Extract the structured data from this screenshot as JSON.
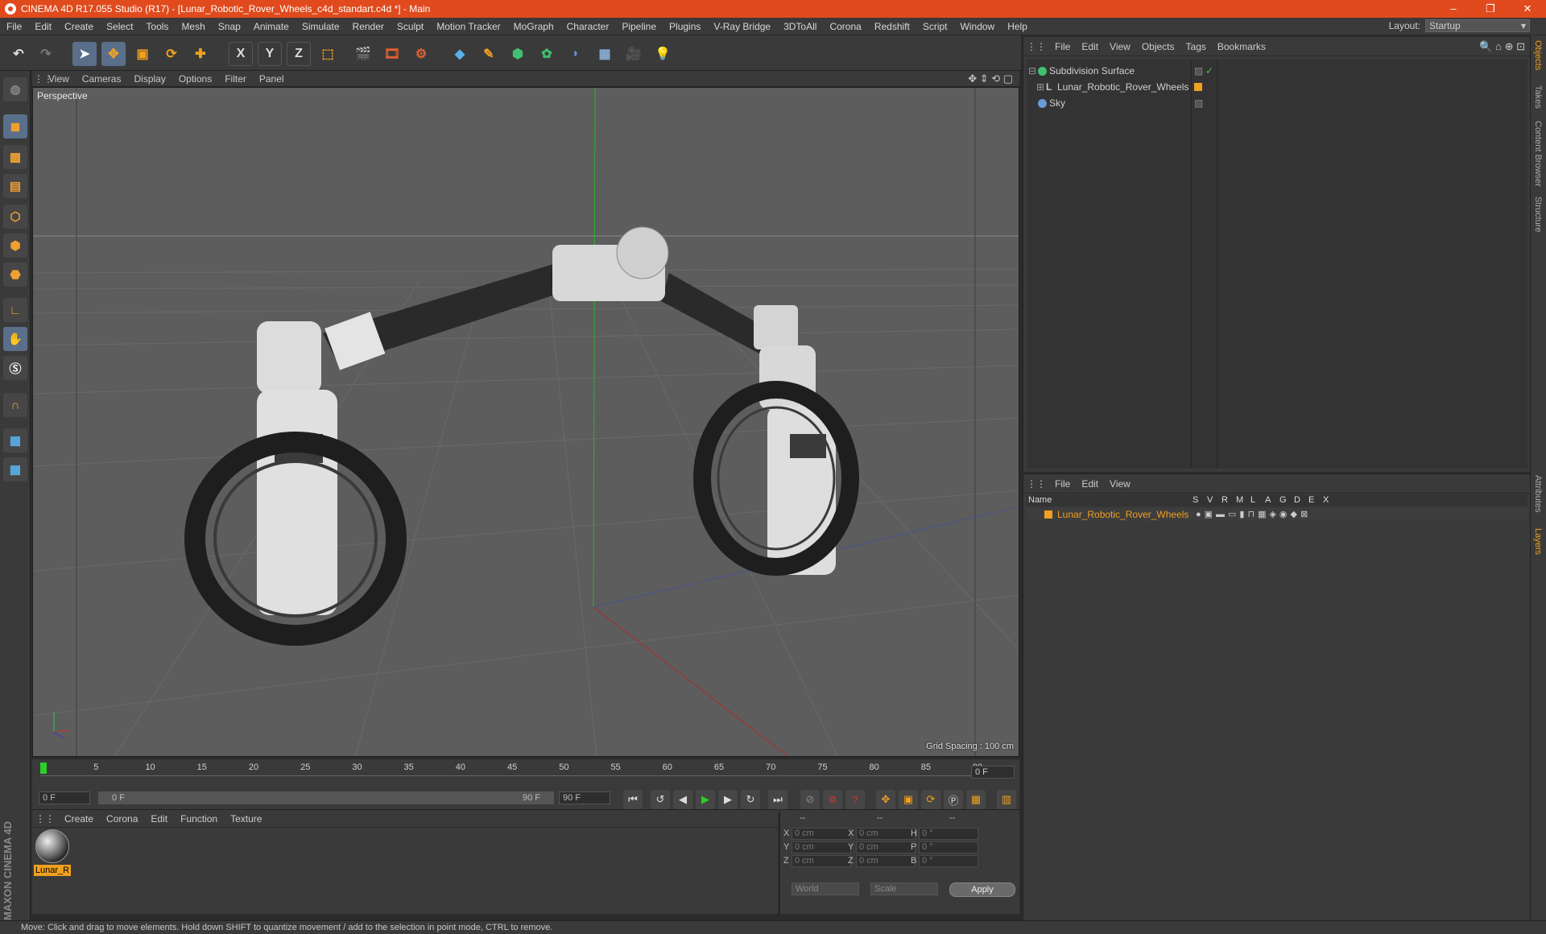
{
  "app": {
    "title": "CINEMA 4D R17.055 Studio (R17) - [Lunar_Robotic_Rover_Wheels_c4d_standart.c4d *] - Main",
    "window_controls": {
      "minimize": "–",
      "restore": "❐",
      "close": "✕"
    }
  },
  "menubar": [
    "File",
    "Edit",
    "Create",
    "Select",
    "Tools",
    "Mesh",
    "Snap",
    "Animate",
    "Simulate",
    "Render",
    "Sculpt",
    "Motion Tracker",
    "MoGraph",
    "Character",
    "Pipeline",
    "Plugins",
    "V-Ray Bridge",
    "3DToAll",
    "Corona",
    "Redshift",
    "Script",
    "Window",
    "Help"
  ],
  "layout": {
    "label": "Layout:",
    "value": "Startup"
  },
  "toolbar": {
    "axis_x": "X",
    "axis_y": "Y",
    "axis_z": "Z"
  },
  "viewport": {
    "menu": [
      "View",
      "Cameras",
      "Display",
      "Options",
      "Filter",
      "Panel"
    ],
    "camera_label": "Perspective",
    "grid_spacing": "Grid Spacing : 100 cm"
  },
  "timeline": {
    "ticks": [
      "0",
      "5",
      "10",
      "15",
      "20",
      "25",
      "30",
      "35",
      "40",
      "45",
      "50",
      "55",
      "60",
      "65",
      "70",
      "75",
      "80",
      "85",
      "90"
    ],
    "current_frame": "0 F"
  },
  "transport": {
    "start_field": "0 F",
    "range_start": "0 F",
    "range_end": "90 F",
    "end_field": "90 F"
  },
  "material_panel": {
    "menu": [
      "Create",
      "Corona",
      "Edit",
      "Function",
      "Texture"
    ],
    "material_name": "Lunar_R"
  },
  "coordinates": {
    "header": [
      "--",
      "--",
      "--"
    ],
    "rows": [
      {
        "a": "X",
        "av": "0 cm",
        "b": "X",
        "bv": "0 cm",
        "c": "H",
        "cv": "0 °"
      },
      {
        "a": "Y",
        "av": "0 cm",
        "b": "Y",
        "bv": "0 cm",
        "c": "P",
        "cv": "0 °"
      },
      {
        "a": "Z",
        "av": "0 cm",
        "b": "Z",
        "bv": "0 cm",
        "c": "B",
        "cv": "0 °"
      }
    ],
    "space": "World",
    "mode": "Scale",
    "apply": "Apply"
  },
  "object_manager": {
    "menu": [
      "File",
      "Edit",
      "View",
      "Objects",
      "Tags",
      "Bookmarks"
    ],
    "objects": [
      "Subdivision Surface",
      "Lunar_Robotic_Rover_Wheels",
      "Sky"
    ]
  },
  "layer_manager": {
    "menu": [
      "File",
      "Edit",
      "View"
    ],
    "columns": [
      "Name",
      "S",
      "V",
      "R",
      "M",
      "L",
      "A",
      "G",
      "D",
      "E",
      "X"
    ],
    "layer_name": "Lunar_Robotic_Rover_Wheels"
  },
  "side_tabs": [
    "Objects",
    "Takes",
    "Content Browser",
    "Structure",
    "Attributes",
    "Layers"
  ],
  "branding": "MAXON CINEMA 4D",
  "status": "Move: Click and drag to move elements. Hold down SHIFT to quantize movement / add to the selection in point mode, CTRL to remove.",
  "colors": {
    "titlebar": "#e04a1c",
    "accent": "#f0a020",
    "highlight": "#5a6f8a"
  }
}
